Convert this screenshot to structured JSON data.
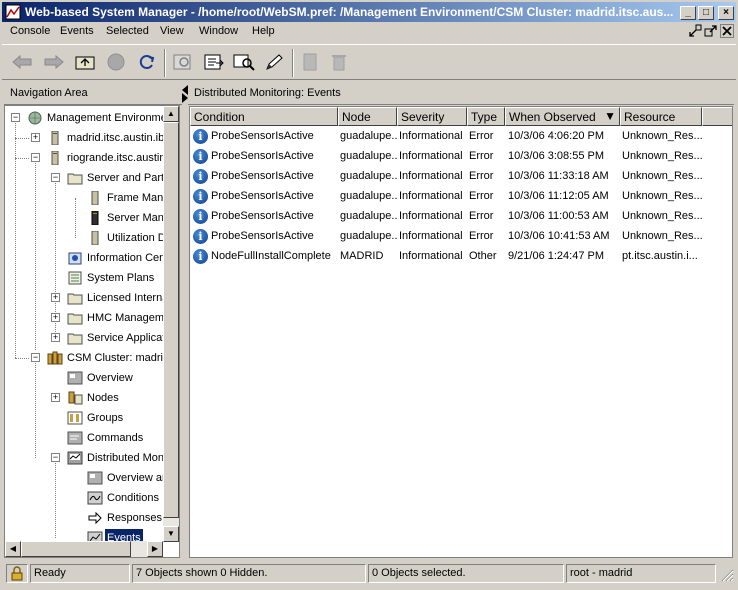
{
  "window": {
    "title": "Web-based System Manager - /home/root/WebSM.pref: /Management Environment/CSM Cluster: madrid.itsc.aus...",
    "minimize": "_",
    "maximize": "□",
    "close": "×"
  },
  "menubar": {
    "items": [
      "Console",
      "Events",
      "Selected",
      "View",
      "Window",
      "Help"
    ]
  },
  "toolbar": {
    "buttons": [
      "back-arrow-icon",
      "forward-arrow-icon",
      "up-level-icon",
      "stop-icon",
      "reload-icon",
      "find-icon",
      "export-icon",
      "search-icon",
      "edit-icon",
      "properties-icon",
      "delete-icon"
    ]
  },
  "navigation": {
    "header": "Navigation Area",
    "nodes": [
      {
        "label": "Management Environment",
        "expander": "−"
      },
      {
        "label": "madrid.itsc.austin.ibm.com",
        "expander": "+"
      },
      {
        "label": "riogrande.itsc.austin.ibm.com",
        "expander": "−"
      },
      {
        "label": "Server and Partition",
        "expander": "−"
      },
      {
        "label": "Frame Management"
      },
      {
        "label": "Server Management"
      },
      {
        "label": "Utilization Data"
      },
      {
        "label": "Information Center"
      },
      {
        "label": "System Plans"
      },
      {
        "label": "Licensed Internal Code",
        "expander": "+"
      },
      {
        "label": "HMC Management",
        "expander": "+"
      },
      {
        "label": "Service Applications",
        "expander": "+"
      },
      {
        "label": "CSM Cluster: madrid.itsc.austin.ibm.com",
        "expander": "−"
      },
      {
        "label": "Overview"
      },
      {
        "label": "Nodes",
        "expander": "+"
      },
      {
        "label": "Groups"
      },
      {
        "label": "Commands"
      },
      {
        "label": "Distributed Monitoring",
        "expander": "−"
      },
      {
        "label": "Overview and Tasks"
      },
      {
        "label": "Conditions"
      },
      {
        "label": "Responses"
      },
      {
        "label": "Events"
      }
    ]
  },
  "content": {
    "header": "Distributed Monitoring: Events",
    "columns": [
      "Condition",
      "Node",
      "Severity",
      "Type",
      "When Observed",
      "Resource"
    ],
    "sort_indicator": "▼",
    "rows": [
      {
        "condition": "ProbeSensorIsActive",
        "node": "guadalupe...",
        "severity": "Informational",
        "type": "Error",
        "when": "10/3/06 4:06:20 PM",
        "resource": "Unknown_Res..."
      },
      {
        "condition": "ProbeSensorIsActive",
        "node": "guadalupe...",
        "severity": "Informational",
        "type": "Error",
        "when": "10/3/06 3:08:55 PM",
        "resource": "Unknown_Res..."
      },
      {
        "condition": "ProbeSensorIsActive",
        "node": "guadalupe...",
        "severity": "Informational",
        "type": "Error",
        "when": "10/3/06 11:33:18 AM",
        "resource": "Unknown_Res..."
      },
      {
        "condition": "ProbeSensorIsActive",
        "node": "guadalupe...",
        "severity": "Informational",
        "type": "Error",
        "when": "10/3/06 11:12:05 AM",
        "resource": "Unknown_Res..."
      },
      {
        "condition": "ProbeSensorIsActive",
        "node": "guadalupe...",
        "severity": "Informational",
        "type": "Error",
        "when": "10/3/06 11:00:53 AM",
        "resource": "Unknown_Res..."
      },
      {
        "condition": "ProbeSensorIsActive",
        "node": "guadalupe...",
        "severity": "Informational",
        "type": "Error",
        "when": "10/3/06 10:41:53 AM",
        "resource": "Unknown_Res..."
      },
      {
        "condition": "NodeFullInstallComplete",
        "node": "MADRID",
        "severity": "Informational",
        "type": "Other",
        "when": "9/21/06 1:24:47 PM",
        "resource": "pt.itsc.austin.i..."
      }
    ]
  },
  "status": {
    "ready": "Ready",
    "objects": "7 Objects shown 0 Hidden.",
    "selected": "0 Objects selected.",
    "user": "root - madrid"
  },
  "colors": {
    "titlebar_start": "#0a246a",
    "titlebar_end": "#a6caf0",
    "face": "#d4d0c8",
    "selection": "#0a246a",
    "info_icon": "#1a5cb5"
  }
}
